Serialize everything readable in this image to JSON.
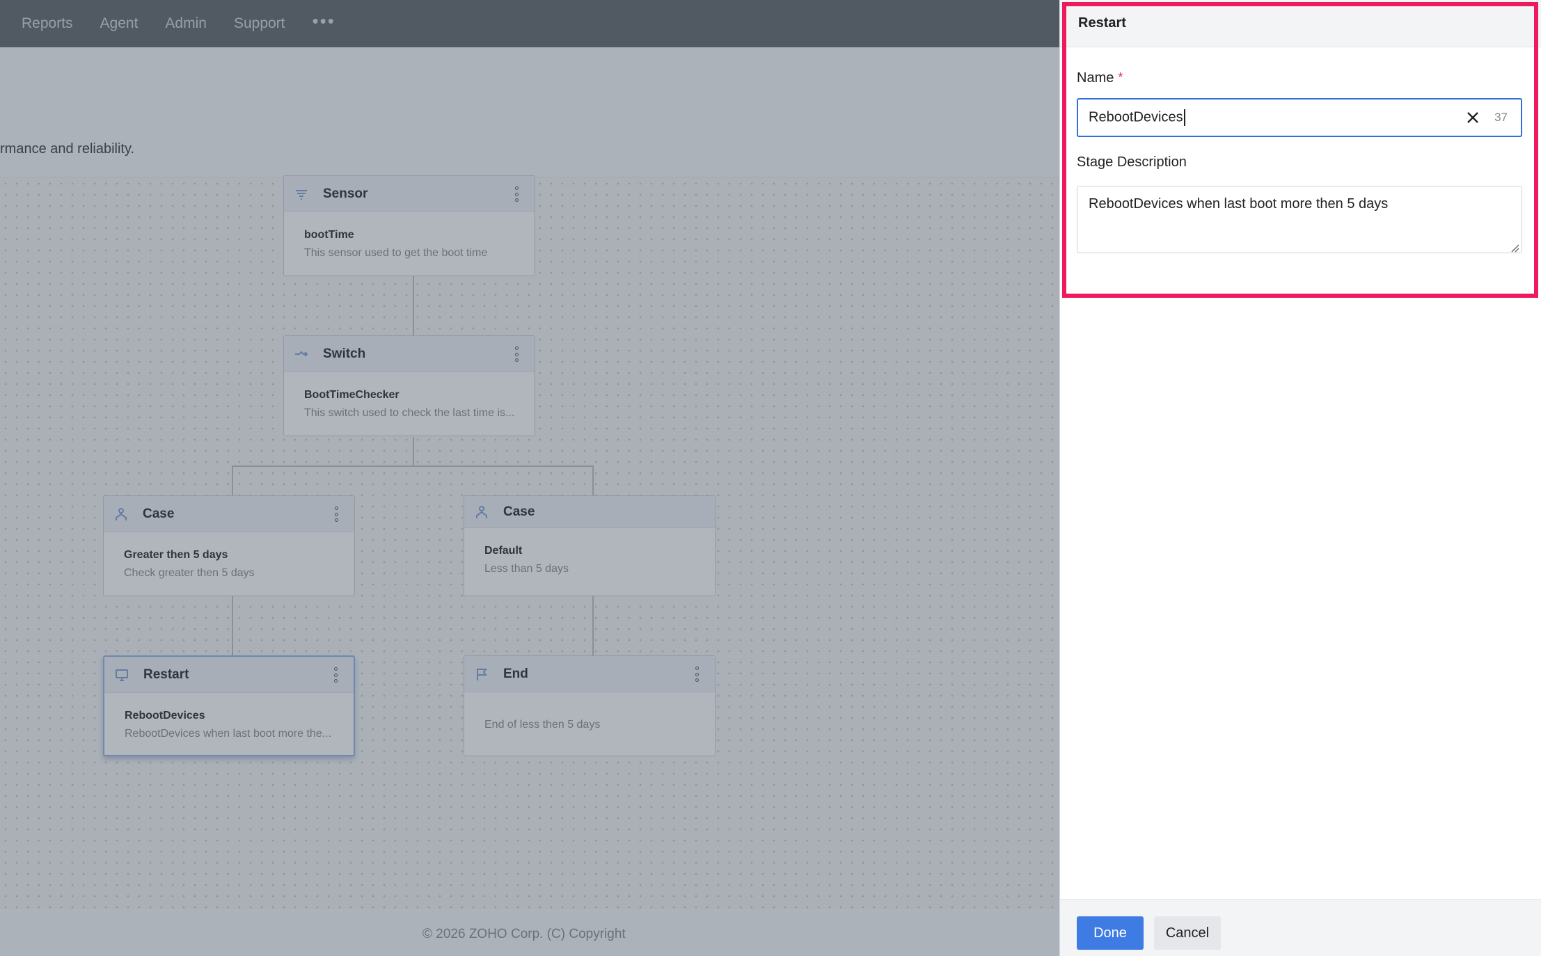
{
  "nav": {
    "items": [
      "Reports",
      "Agent",
      "Admin",
      "Support"
    ],
    "more_label": "•••"
  },
  "page": {
    "description_fragment": "rmance and reliability."
  },
  "workflow": {
    "nodes": [
      {
        "type": "Sensor",
        "name": "bootTime",
        "desc": "This sensor used to get the boot time",
        "icon": "sensor-icon"
      },
      {
        "type": "Switch",
        "name": "BootTimeChecker",
        "desc": "This switch used to check the last time is...",
        "icon": "switch-icon"
      },
      {
        "type": "Case",
        "name": "Greater then 5 days",
        "desc": "Check greater then 5 days",
        "icon": "case-icon"
      },
      {
        "type": "Case",
        "name": "Default",
        "desc": "Less than 5 days",
        "icon": "case-icon"
      },
      {
        "type": "Restart",
        "name": "RebootDevices",
        "desc": "RebootDevices when last boot more the...",
        "icon": "restart-icon"
      },
      {
        "type": "End",
        "name": "",
        "desc": "End of less then 5 days",
        "icon": "flag-icon"
      }
    ]
  },
  "footer": {
    "copyright": "© 2026 ZOHO Corp. (C) Copyright"
  },
  "panel": {
    "title": "Restart",
    "name_label": "Name",
    "required_mark": "*",
    "name_value": "RebootDevices",
    "name_counter": "37",
    "description_label": "Stage Description",
    "description_value": "RebootDevices when last boot more then 5 days",
    "done_label": "Done",
    "cancel_label": "Cancel"
  },
  "colors": {
    "accent": "#3e7be3",
    "highlight": "#ef1a5d",
    "required": "#e0245e"
  }
}
